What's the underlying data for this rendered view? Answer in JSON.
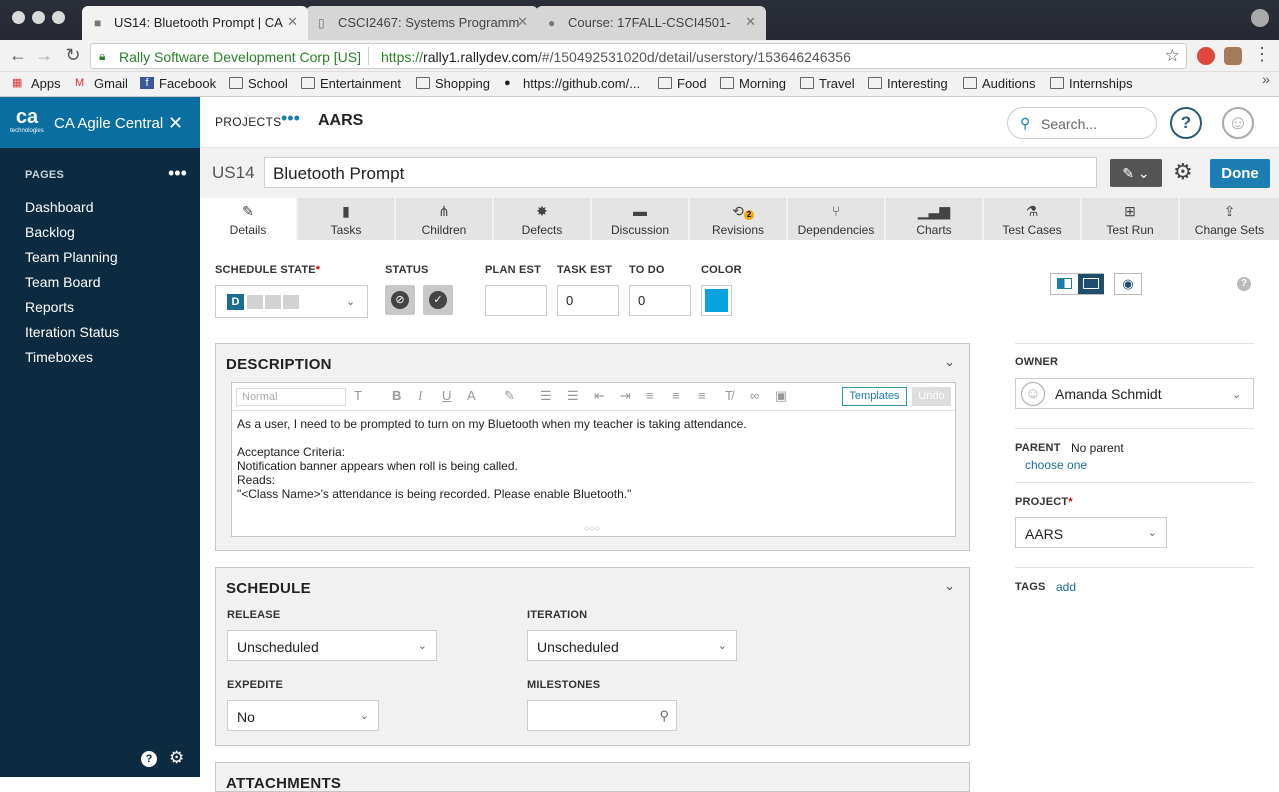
{
  "browser": {
    "tabs": [
      {
        "title": "US14: Bluetooth Prompt | CA",
        "active": true
      },
      {
        "title": "CSCI2467: Systems Programm",
        "active": false
      },
      {
        "title": "Course: 17FALL-CSCI4501-",
        "active": false
      }
    ],
    "address": {
      "site": "Rally Software Development Corp [US]",
      "url_scheme": "https://",
      "url_host": "rally1.rallydev.com",
      "url_path": "/#/150492531020d/detail/userstory/153646246356"
    },
    "bookmarks": [
      "Apps",
      "Gmail",
      "Facebook",
      "School",
      "Entertainment",
      "Shopping",
      "https://github.com/...",
      "Food",
      "Morning",
      "Travel",
      "Interesting",
      "Auditions",
      "Internships"
    ]
  },
  "sidebar": {
    "logo": "ca",
    "logo_sub": "technologies",
    "app_title": "CA Agile Central",
    "pages_label": "PAGES",
    "items": [
      "Dashboard",
      "Backlog",
      "Team Planning",
      "Team Board",
      "Reports",
      "Iteration Status",
      "Timeboxes"
    ]
  },
  "topbar": {
    "projects_label": "PROJECTS",
    "project_name": "AARS",
    "search_placeholder": "Search..."
  },
  "story": {
    "id": "US14",
    "name": "Bluetooth Prompt",
    "done_label": "Done"
  },
  "tabs": [
    {
      "label": "Details",
      "icon": "pencil-icon"
    },
    {
      "label": "Tasks",
      "icon": "clipboard-icon"
    },
    {
      "label": "Children",
      "icon": "hierarchy-icon"
    },
    {
      "label": "Defects",
      "icon": "bug-icon"
    },
    {
      "label": "Discussion",
      "icon": "comment-icon"
    },
    {
      "label": "Revisions",
      "icon": "history-icon",
      "badge": "2"
    },
    {
      "label": "Dependencies",
      "icon": "branch-icon"
    },
    {
      "label": "Charts",
      "icon": "bar-chart-icon"
    },
    {
      "label": "Test Cases",
      "icon": "flask-icon"
    },
    {
      "label": "Test Run",
      "icon": "test-run-icon"
    },
    {
      "label": "Change Sets",
      "icon": "upload-icon"
    }
  ],
  "fields": {
    "schedule_state_label": "SCHEDULE STATE",
    "schedule_state_value": "D",
    "status_label": "STATUS",
    "plan_est_label": "PLAN EST",
    "plan_est_value": "",
    "task_est_label": "TASK EST",
    "task_est_value": "0",
    "todo_label": "TO DO",
    "todo_value": "0",
    "color_label": "COLOR",
    "color_value": "#0aa1e0"
  },
  "description": {
    "title": "DESCRIPTION",
    "format_placeholder": "Normal",
    "templates_label": "Templates",
    "undo_label": "Undo",
    "lines": [
      "As a user, I need to be prompted to turn on my Bluetooth when my teacher is taking attendance.",
      "",
      "Acceptance Criteria:",
      "Notification banner appears when roll is being called.",
      "Reads:",
      "\"<Class Name>'s attendance is being recorded. Please enable Bluetooth.\""
    ]
  },
  "schedule": {
    "title": "SCHEDULE",
    "release_label": "RELEASE",
    "release_value": "Unscheduled",
    "iteration_label": "ITERATION",
    "iteration_value": "Unscheduled",
    "expedite_label": "EXPEDITE",
    "expedite_value": "No",
    "milestones_label": "MILESTONES"
  },
  "attachments_title": "ATTACHMENTS",
  "right_panel": {
    "owner_label": "OWNER",
    "owner_value": "Amanda Schmidt",
    "parent_label": "PARENT",
    "parent_value": "No parent",
    "parent_link": "choose one",
    "project_label": "PROJECT",
    "project_value": "AARS",
    "tags_label": "TAGS",
    "tags_link": "add"
  }
}
